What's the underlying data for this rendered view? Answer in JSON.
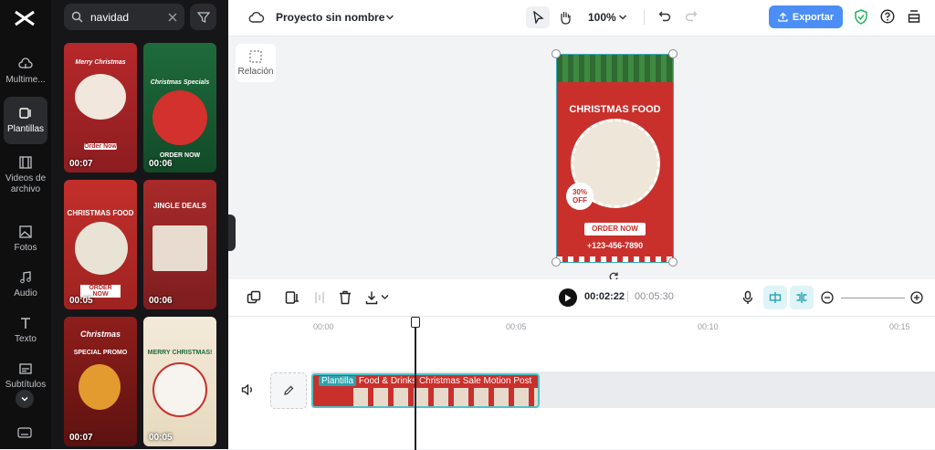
{
  "sidebar": {
    "items": [
      {
        "label": "Multime..."
      },
      {
        "label": "Plantillas"
      },
      {
        "label": "Videos de archivo"
      },
      {
        "label": "Fotos"
      },
      {
        "label": "Audio"
      },
      {
        "label": "Texto"
      },
      {
        "label": "Subtítulos"
      }
    ]
  },
  "search": {
    "value": "navidad"
  },
  "templates": [
    {
      "duration": "00:07",
      "title": "Merry Christmas",
      "cta": "Order Now"
    },
    {
      "duration": "00:06",
      "title": "Christmas Specials",
      "cta": "ORDER NOW"
    },
    {
      "duration": "00:05",
      "title": "CHRISTMAS FOOD",
      "cta": "ORDER NOW"
    },
    {
      "duration": "00:06",
      "title": "JINGLE DEALS",
      "cta": ""
    },
    {
      "duration": "00:07",
      "title": "Christmas",
      "cta": "SPECIAL PROMO"
    },
    {
      "duration": "00:05",
      "title": "MERRY CHRISTMAS!",
      "cta": ""
    }
  ],
  "header": {
    "project_name": "Proyecto sin nombre",
    "zoom": "100%",
    "export_label": "Exportar"
  },
  "ratio_label": "Relación",
  "canvas": {
    "title": "CHRISTMAS FOOD",
    "discount": "30% OFF",
    "cta": "ORDER NOW",
    "phone": "+123-456-7890"
  },
  "timeline": {
    "current": "00:02:22",
    "total": "00:05:30",
    "ticks": [
      "00:00",
      "00:05",
      "00:10",
      "00:15"
    ],
    "clip_tag": "Plantilla",
    "clip_name": "Food & Drinks Christmas Sale Motion Post"
  },
  "colors": {
    "accent": "#4a8ef6",
    "clip_border": "#4fc3c8",
    "template_red": "#c9302c"
  }
}
